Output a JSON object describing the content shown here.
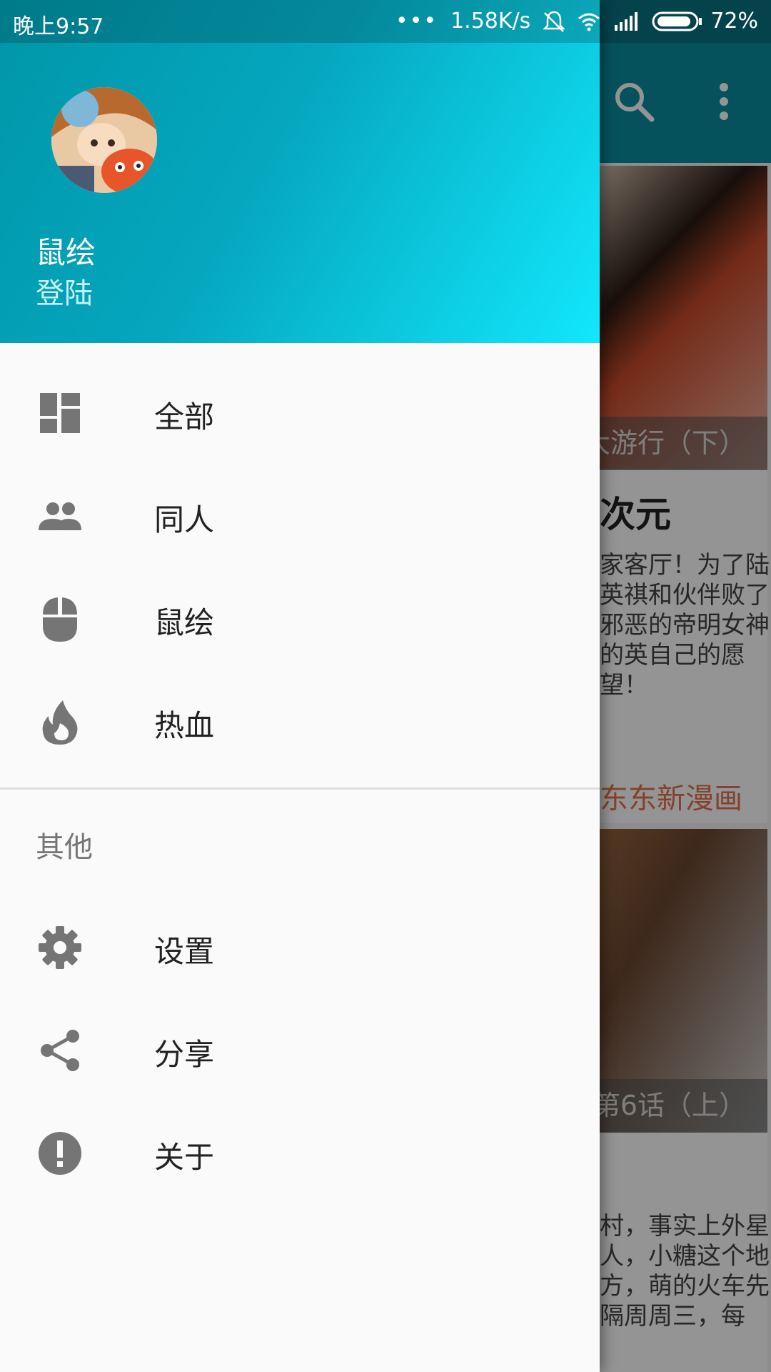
{
  "status_bar": {
    "time": "晚上9:57",
    "dots": "•••",
    "speed": "1.58K/s",
    "battery": "72%"
  },
  "background": {
    "caption1": "大游行（下）",
    "title": "次元",
    "desc1": "家客厅！为了陆英祺和伙伴败了邪恶的帝明女神的英自己的愿望！",
    "link": "东东新漫画",
    "caption2": "第6话（上）",
    "desc2": "村，事实上外星人，小糖这个地方，萌的火车先隔周周三，每"
  },
  "drawer": {
    "header": {
      "user_name": "鼠绘",
      "login": "登陆"
    },
    "items": [
      {
        "label": "全部",
        "icon": "dashboard-icon"
      },
      {
        "label": "同人",
        "icon": "people-icon"
      },
      {
        "label": "鼠绘",
        "icon": "mouse-icon"
      },
      {
        "label": "热血",
        "icon": "fire-icon"
      }
    ],
    "section_title": "其他",
    "other_items": [
      {
        "label": "设置",
        "icon": "gear-icon"
      },
      {
        "label": "分享",
        "icon": "share-icon"
      },
      {
        "label": "关于",
        "icon": "alert-icon"
      }
    ]
  },
  "colors": {
    "header_start": "#0096a8",
    "header_end": "#12e7fb",
    "icon_gray": "#757575",
    "drawer_bg": "#fafafa"
  }
}
